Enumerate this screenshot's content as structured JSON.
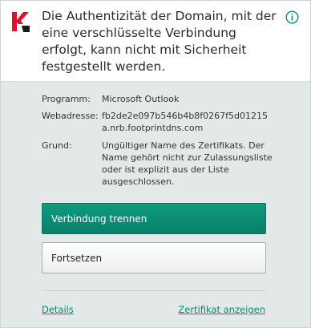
{
  "header": {
    "title": "Die Authentizität der Domain, mit der eine verschlüsselte Verbindung erfolgt, kann nicht mit Sicherheit festgestellt werden.",
    "logo_icon": "kaspersky-k-icon",
    "info_icon": "info-circle-icon",
    "accent_color": "#0a8a6f",
    "logo_color": "#e2102a"
  },
  "details": {
    "program_label": "Programm:",
    "program_value": "Microsoft Outlook",
    "address_label": "Webadresse:",
    "address_value": "fb2de2e097b546b4b8f0267f5d01215a.nrb.footprintdns.com",
    "reason_label": "Grund:",
    "reason_value": "Ungültiger Name des Zertifikats. Der Name gehört nicht zur Zulassungsliste oder ist explizit aus der Liste ausgeschlossen."
  },
  "actions": {
    "disconnect_label": "Verbindung trennen",
    "continue_label": "Fortsetzen",
    "primary_color": "#07806a"
  },
  "footer": {
    "details_link": "Details",
    "certificate_link": "Zertifikat anzeigen"
  }
}
